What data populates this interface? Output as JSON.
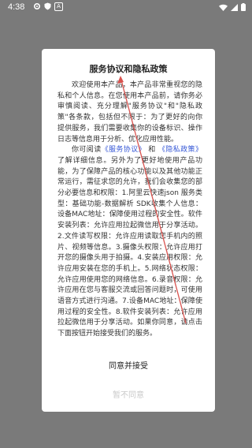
{
  "status_bar": {
    "time": "4:38",
    "icons": [
      "settings-icon",
      "shield-icon",
      "a-notification-icon",
      "wifi-icon",
      "signal-icon",
      "battery-icon"
    ],
    "a_label": "A"
  },
  "dialog": {
    "title": "服务协议和隐私政策",
    "intro": "欢迎使用本产品，本产品非常重视您的隐私和个人信息。在您使用本产品前，请你务必审慎阅读、充分理解\"服务协议\"和\"隐私政策\"各条款，包括但不限于：为了更好的向你提供服务，我们需要收集你的设备标识、操作日志等信息用于分析、优化应用性能。",
    "body_prefix": "你可阅读",
    "service_link": "《服务协议》",
    "and_text": "和",
    "privacy_link": "《隐私政策》",
    "body_rest": "了解详细信息。另外为了更好地使用产品功能，为了保障产品的核心功能以及其他功能正常运行，需征求您的允许，我们会收集您的部分必要信息和权限：1.阿里云快速json 服务类型：基础功能-数据解析 SDK收集个人信息：设备MAC地址：保障使用过程的安全性。软件安装列表：允许应用拉起微信用于分享活动。2.文件读写权限：允许应用读取您手机内的照片、视频等信息。3.摄像头权限：允许应用打开您的摄像头用于拍摄。4.安装应用权限：允许应用安装在您的手机上。5.网络状态权限：允许应用使用您的网络信息。6.录音权限：允许应用在您与客服交流或回答问题时，可使用语音方式进行沟通。7.设备MAC地址：保障使用过程的安全性。8.软件安装列表：允许应用拉起微信用于分享活动。如果你同意，请点击下面按钮开始接受我们的服务。",
    "agree_label": "同意并接受",
    "disagree_label": "暂不同意"
  },
  "colors": {
    "overlay": "#7a7a7a",
    "dialog_bg": "#ffffff",
    "link": "#3557d6",
    "annotation_arrow": "#d9534f",
    "disabled_text": "#c9c9c9"
  }
}
